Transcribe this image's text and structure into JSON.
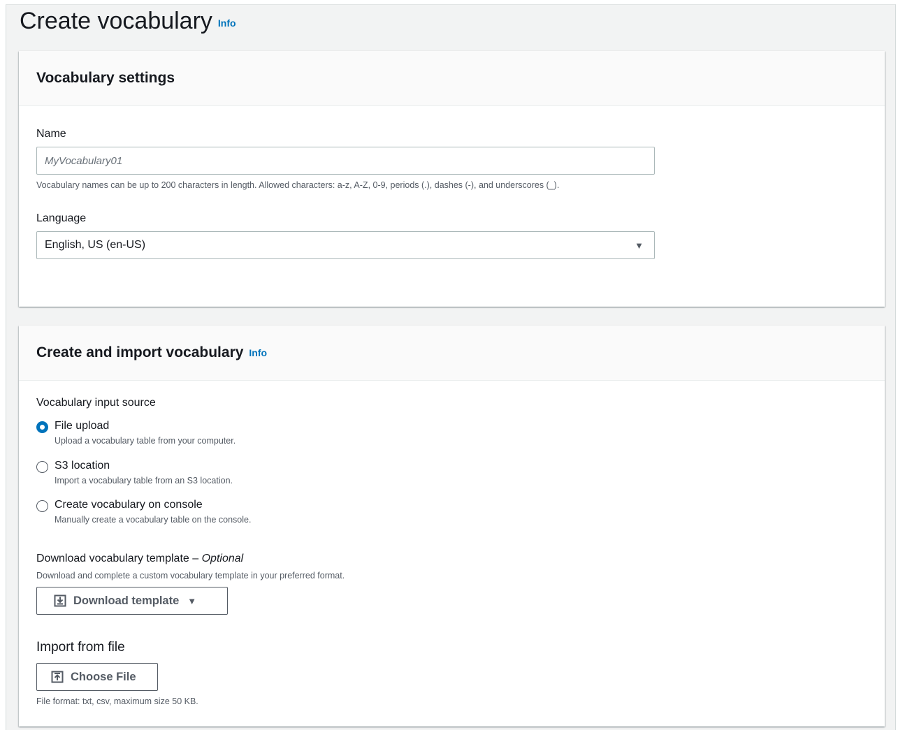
{
  "page": {
    "title": "Create vocabulary",
    "info": "Info"
  },
  "settings": {
    "title": "Vocabulary settings",
    "name_label": "Name",
    "name_placeholder": "MyVocabulary01",
    "name_hint": "Vocabulary names can be up to 200 characters in length. Allowed characters: a-z, A-Z, 0-9, periods (.), dashes (-), and underscores (_).",
    "language_label": "Language",
    "language_value": "English, US (en-US)"
  },
  "import": {
    "title": "Create and import vocabulary",
    "info": "Info",
    "source_label": "Vocabulary input source",
    "options": [
      {
        "label": "File upload",
        "desc": "Upload a vocabulary table from your computer.",
        "checked": true
      },
      {
        "label": "S3 location",
        "desc": "Import a vocabulary table from an S3 location.",
        "checked": false
      },
      {
        "label": "Create vocabulary on console",
        "desc": "Manually create a vocabulary table on the console.",
        "checked": false
      }
    ],
    "template_label": "Download vocabulary template –",
    "template_optional": "Optional",
    "template_hint": "Download and complete a custom vocabulary template in your preferred format.",
    "download_button": "Download template",
    "import_label": "Import from file",
    "choose_button": "Choose File",
    "file_hint": "File format: txt, csv, maximum size 50 KB."
  },
  "colors": {
    "accent": "#0073bb",
    "background": "#f2f3f3",
    "text": "#16191f",
    "secondary_text": "#545b64"
  },
  "icons": [
    "caret-down-icon",
    "download-icon",
    "upload-icon"
  ]
}
